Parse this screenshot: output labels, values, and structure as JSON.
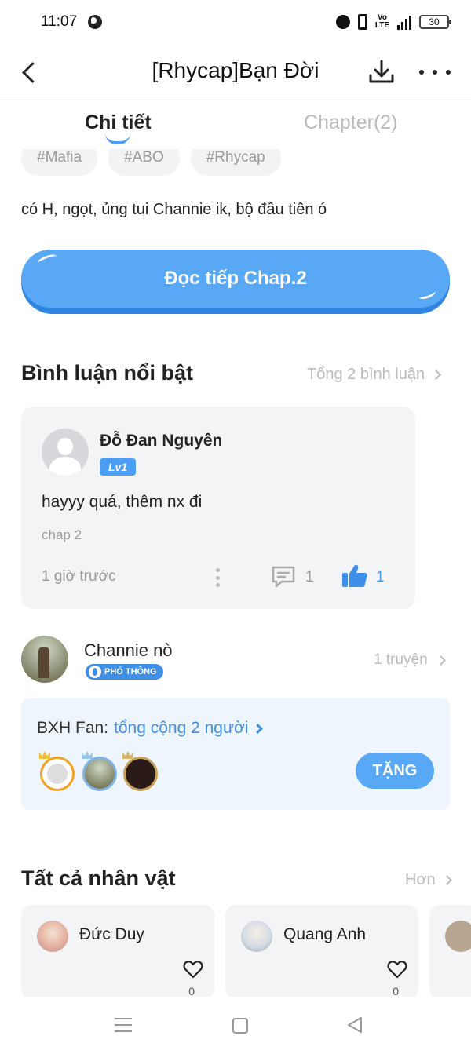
{
  "status_bar": {
    "time": "11:07",
    "battery": "30"
  },
  "header": {
    "title": "[Rhycap]Bạn Đời"
  },
  "tabs": [
    {
      "label": "Chi tiết",
      "active": true
    },
    {
      "label": "Chapter(2)",
      "active": false
    }
  ],
  "tags": [
    "#Mafia",
    "#ABO",
    "#Rhycap"
  ],
  "description": "có H, ngọt, ủng tui Channie ik, bộ đầu tiên ó",
  "read_button": {
    "label": "Đọc tiếp Chap.2"
  },
  "comments": {
    "title": "Bình luận nổi bật",
    "total_link": "Tổng 2 bình luận",
    "items": [
      {
        "user": "Đỗ Đan Nguyên",
        "level": "Lv1",
        "text": "hayyy quá, thêm nx đi",
        "chapter": "chap 2",
        "time": "1 giờ trước",
        "replies": "1",
        "likes": "1"
      }
    ]
  },
  "author": {
    "name": "Channie nò",
    "badge": "PHỔ THÔNG",
    "stories_link": "1 truyện"
  },
  "fan_ranking": {
    "label": "BXH Fan:",
    "total": "tổng cộng 2 người",
    "gift_button": "TẶNG"
  },
  "characters": {
    "title": "Tất cả nhân vật",
    "more_link": "Hơn",
    "items": [
      {
        "name": "Đức Duy",
        "likes": "0"
      },
      {
        "name": "Quang Anh",
        "likes": "0"
      }
    ]
  },
  "colors": {
    "accent": "#4a9ff5",
    "button": "#58a8f5",
    "card_bg": "#f3f4f6",
    "fan_bg": "#eef5fd"
  }
}
